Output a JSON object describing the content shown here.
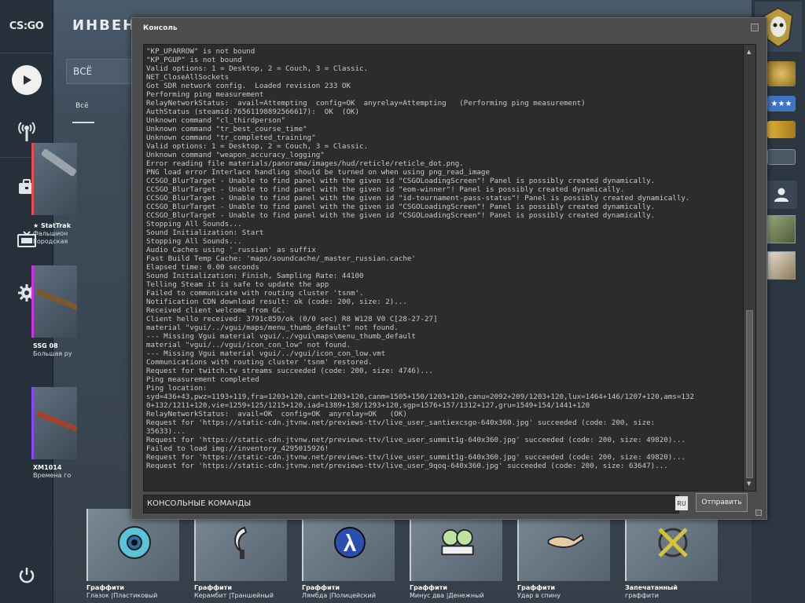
{
  "nav": {
    "logo": "CS:GO",
    "items": [
      {
        "icon": "play-icon"
      },
      {
        "icon": "broadcast-icon"
      },
      {
        "icon": "inventory-icon"
      },
      {
        "icon": "tv-icon"
      },
      {
        "icon": "gear-icon"
      },
      {
        "icon": "power-icon"
      }
    ]
  },
  "inventory": {
    "title": "ИНВЕНТ",
    "filter_value": "ВСЁ",
    "tab_all": "Всё",
    "items": [
      {
        "line1": "★ StatTrak",
        "line2": "Фальшион",
        "line3": "Городская",
        "rarity_color": "#eb4b4b"
      },
      {
        "line1": "SSG 08",
        "line2": "Большая ру",
        "line3": "",
        "rarity_color": "#d32ee6"
      },
      {
        "line1": "XM1014",
        "line2": "Времена го",
        "line3": "",
        "rarity_color": "#8847ff"
      }
    ],
    "graffiti": [
      {
        "line1": "Граффити",
        "line2": "Глазок |Пластиковый"
      },
      {
        "line1": "Граффити",
        "line2": "Керамбит |Траншейный"
      },
      {
        "line1": "Граффити",
        "line2": "Лямбда |Полицейский"
      },
      {
        "line1": "Граффити",
        "line2": "Минус два |Денежный"
      },
      {
        "line1": "Граффити",
        "line2": "Удар в спину"
      },
      {
        "line1": "Запечатанный",
        "line2": "граффити"
      }
    ]
  },
  "console": {
    "title": "Консоль",
    "log": [
      "\"KP_UPARROW\" is not bound",
      "\"KP_PGUP\" is not bound",
      "Valid options: 1 = Desktop, 2 = Couch, 3 = Classic.",
      "NET_CloseAllSockets",
      "Got SDR network config.  Loaded revision 233 OK",
      "Performing ping measurement",
      "RelayNetworkStatus:  avail=Attempting  config=OK  anyrelay=Attempting   (Performing ping measurement)",
      "AuthStatus (steamid:76561198892566617):  OK  (OK)",
      "Unknown command \"cl_thirdperson\"",
      "Unknown command \"tr_best_course_time\"",
      "Unknown command \"tr_completed_training\"",
      "Valid options: 1 = Desktop, 2 = Couch, 3 = Classic.",
      "Unknown command \"weapon_accuracy_logging\"",
      "Error reading file materials/panorama/images/hud/reticle/reticle_dot.png.",
      "PNG load error Interlace handling should be turned on when using png_read_image",
      "CCSGO_BlurTarget - Unable to find panel with the given id \"CSGOLoadingScreen\"! Panel is possibly created dynamically.",
      "CCSGO_BlurTarget - Unable to find panel with the given id \"eom-winner\"! Panel is possibly created dynamically.",
      "CCSGO_BlurTarget - Unable to find panel with the given id \"id-tournament-pass-status\"! Panel is possibly created dynamically.",
      "CCSGO_BlurTarget - Unable to find panel with the given id \"CSGOLoadingScreen\"! Panel is possibly created dynamically.",
      "CCSGO_BlurTarget - Unable to find panel with the given id \"CSGOLoadingScreen\"! Panel is possibly created dynamically.",
      "Stopping All Sounds...",
      "Sound Initialization: Start",
      "Stopping All Sounds...",
      "Audio Caches using '_russian' as suffix",
      "Fast Build Temp Cache: 'maps/soundcache/_master_russian.cache'",
      "Elapsed time: 0.00 seconds",
      "Sound Initialization: Finish, Sampling Rate: 44100",
      "Telling Steam it is safe to update the app",
      "Failed to communicate with routing cluster 'tsnm'.",
      "Notification CDN download result: ok (code: 200, size: 2)...",
      "Received client welcome from GC.",
      "Client hello received: 3791c859/ok (0/0 sec) R8 W128 V0 C[28-27-27]",
      "material \"vgui/../vgui/maps/menu_thumb_default\" not found.",
      "--- Missing Vgui material vgui/../vgui\\maps\\menu_thumb_default",
      "material \"vgui/../vgui/icon_con_low\" not found.",
      "--- Missing Vgui material vgui/../vgui/icon_con_low.vmt",
      "Communications with routing cluster 'tsnm' restored.",
      "Request for twitch.tv streams succeeded (code: 200, size: 4746)...",
      "Ping measurement completed",
      "Ping location:",
      "syd=436+43,pwz=1193+119,fra=1203+120,cant=1203+120,canm=1505+150/1203+120,canu=2092+209/1203+120,lux=1464+146/1207+120,ams=132",
      "0+132/1211+120,vie=1259+125/1215+120,iad=1389+138/1293+120,sgp=1576+157/1312+127,gru=1549+154/1441+120",
      "RelayNetworkStatus:  avail=OK  config=OK  anyrelay=OK   (OK)",
      "Request for 'https://static-cdn.jtvnw.net/previews-ttv/live_user_santiexcsgo-640x360.jpg' succeeded (code: 200, size:",
      "35633)...",
      "Request for 'https://static-cdn.jtvnw.net/previews-ttv/live_user_summit1g-640x360.jpg' succeeded (code: 200, size: 49820)...",
      "Failed to load img://inventory_4295015926!",
      "Request for 'https://static-cdn.jtvnw.net/previews-ttv/live_user_summit1g-640x360.jpg' succeeded (code: 200, size: 49820)...",
      "Request for 'https://static-cdn.jtvnw.net/previews-ttv/live_user_9qoq-640x360.jpg' succeeded (code: 200, size: 63647)..."
    ],
    "input_value": "КОНСОЛЬНЫЕ КОМАНДЫ",
    "lang": "RU",
    "send_label": "Отправить"
  },
  "colors": {
    "accent_blue": "#3f74c4",
    "gold": "#c9a227"
  }
}
